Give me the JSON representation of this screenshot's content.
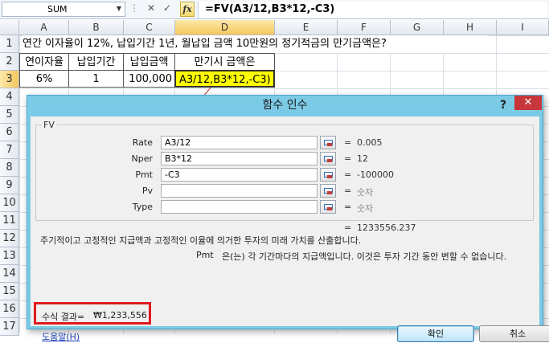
{
  "formula_bar": {
    "name_box": "SUM",
    "cancel_glyph": "✕",
    "enter_glyph": "✓",
    "fx_label": "fx",
    "formula": "=FV(A3/12,B3*12,-C3)"
  },
  "sheet": {
    "columns": [
      "A",
      "B",
      "C",
      "D",
      "E",
      "F",
      "G",
      "H",
      "I"
    ],
    "rows": [
      "1",
      "2",
      "3",
      "4",
      "5",
      "6",
      "7",
      "8",
      "9",
      "10",
      "11",
      "12",
      "13",
      "14",
      "15",
      "16",
      "17"
    ],
    "title": "연간 이자율이 12%, 납입기간 1년, 월납입 금액 10만원의 정기적금의 만기금액은?",
    "headers": [
      "연이자율",
      "납입기간",
      "납입금액",
      "만기시 금액은"
    ],
    "values": [
      "6%",
      "1",
      "100,000",
      "A3/12,B3*12,-C3)"
    ]
  },
  "dialog": {
    "title": "함수 인수",
    "help_glyph": "?",
    "close_glyph": "✕",
    "function_name": "FV",
    "args": [
      {
        "label": "Rate",
        "input": "A3/12",
        "value": "0.005"
      },
      {
        "label": "Nper",
        "input": "B3*12",
        "value": "12"
      },
      {
        "label": "Pmt",
        "input": "-C3",
        "value": "-100000"
      },
      {
        "label": "Pv",
        "input": "",
        "value": "숫자"
      },
      {
        "label": "Type",
        "input": "",
        "value": "숫자"
      }
    ],
    "equals": "=",
    "result_value": "1233556.237",
    "description": "주기적이고 고정적인 지급액과 고정적인 이율에 의거한 투자의 미래 가치를 산출합니다.",
    "arg_help_name": "Pmt",
    "arg_help_text": "은(는) 각 기간마다의 지급액입니다. 이것은 투자 기간 동안 변할 수 없습니다.",
    "formula_result_label": "수식 결과=",
    "formula_result": "₩1,233,556",
    "help_link": "도움말(H)",
    "ok_label": "확인",
    "cancel_label": "취소"
  },
  "colors": {
    "dialog_frame": "#7ccbe6",
    "result_highlight": "#e0191f",
    "selected_cell": "#ffff00"
  }
}
